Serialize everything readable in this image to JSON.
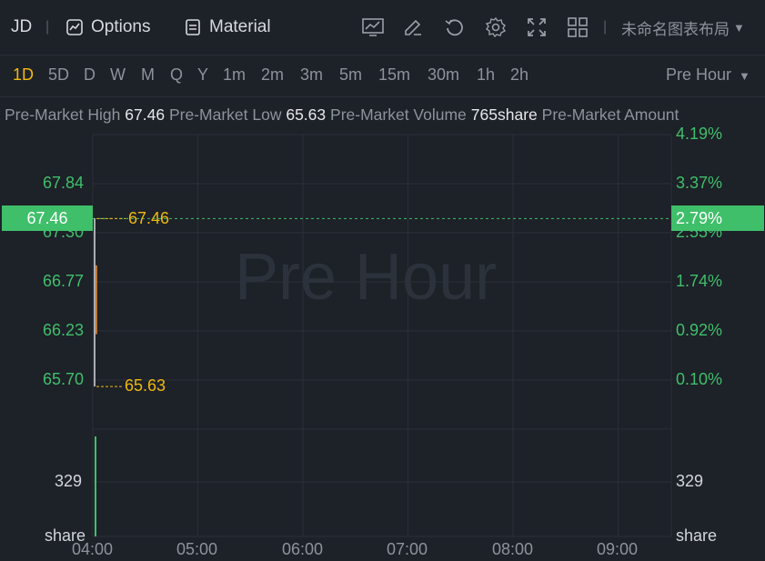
{
  "toolbar": {
    "symbol": "JD",
    "options_label": "Options",
    "material_label": "Material",
    "layout_name": "未命名图表布局",
    "icons": [
      "indicator-icon",
      "draw-icon",
      "undo-icon",
      "settings-icon",
      "fullscreen-icon",
      "layout-grid-icon"
    ]
  },
  "timeframes": [
    "1D",
    "5D",
    "D",
    "W",
    "M",
    "Q",
    "Y",
    "1m",
    "2m",
    "3m",
    "5m",
    "15m",
    "30m",
    "1h",
    "2h"
  ],
  "active_timeframe": "1D",
  "session_select": "Pre Hour",
  "stats": {
    "high_label": "Pre-Market High",
    "high_value": "67.46",
    "low_label": "Pre-Market Low",
    "low_value": "65.63",
    "volume_label": "Pre-Market Volume",
    "volume_value": "765share",
    "amount_label": "Pre-Market Amount"
  },
  "watermark": "Pre Hour",
  "colors": {
    "up": "#3fbf6a",
    "highlight": "#f0b90b",
    "background": "#1d2128",
    "grid": "#2a3038"
  },
  "chart_data": {
    "type": "line",
    "x_ticks": [
      "04:00",
      "05:00",
      "06:00",
      "07:00",
      "08:00",
      "09:00"
    ],
    "price_ticks_left": [
      "67.84",
      "67.30",
      "66.77",
      "66.23",
      "65.70"
    ],
    "percent_ticks_right": [
      "4.19%",
      "3.37%",
      "2.55%",
      "1.74%",
      "0.92%",
      "0.10%"
    ],
    "current_price": "67.46",
    "current_percent": "2.79%",
    "high_marker": "67.46",
    "low_marker": "65.63",
    "price_series": [
      {
        "x": "04:00",
        "y": 65.63
      },
      {
        "x": "04:00",
        "y": 67.46
      }
    ],
    "volume_ticks_left": [
      "329",
      "share"
    ],
    "volume_ticks_right": [
      "329",
      "share"
    ],
    "volume_series": [
      {
        "x": "04:00",
        "y": 765
      }
    ]
  }
}
